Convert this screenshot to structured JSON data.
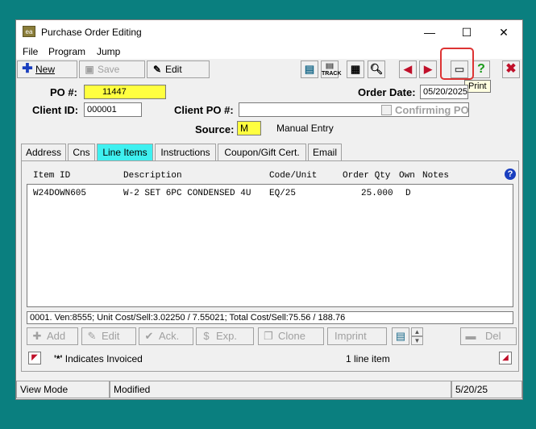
{
  "window": {
    "title": "Purchase Order Editing",
    "icon": "app-icon",
    "controls": {
      "minimize": "—",
      "maximize": "☐",
      "close": "✕"
    }
  },
  "menu": [
    "File",
    "Program",
    "Jump"
  ],
  "toolbar": {
    "new_label": "New",
    "save_label": "Save",
    "edit_label": "Edit",
    "tooltip": "Print",
    "icons": [
      "copy-icon",
      "barcode-track-icon",
      "form-icon",
      "search-icon",
      "prev-arrow-icon",
      "next-arrow-icon",
      "print-icon",
      "help-icon",
      "close-icon"
    ],
    "track_label": "TRACK"
  },
  "header": {
    "po_label": "PO #:",
    "po_value": "11447",
    "order_date_label": "Order Date:",
    "order_date_value": "05/20/2025",
    "client_id_label": "Client ID:",
    "client_id_value": "000001",
    "client_po_label": "Client PO #:",
    "client_po_value": "",
    "confirming_label": "Confirming PO",
    "source_label": "Source:",
    "source_value": "M",
    "source_desc": "Manual Entry"
  },
  "tabs": [
    "Address",
    "Cns",
    "Line Items",
    "Instructions",
    "Coupon/Gift Cert.",
    "Email"
  ],
  "active_tab": "Line Items",
  "grid": {
    "columns": [
      "Item ID",
      "Description",
      "Code/Unit",
      "Order Qty",
      "Own",
      "Notes"
    ],
    "rows": [
      {
        "item_id": "W24DOWN605",
        "description": "W-2 SET 6PC CONDENSED 4U",
        "code_unit": "EQ/25",
        "qty": "25.000",
        "own": "D",
        "notes": ""
      }
    ]
  },
  "detail_line": "0001. Ven:8555; Unit Cost/Sell:3.02250 / 7.55021; Total Cost/Sell:75.56 / 188.76",
  "line_buttons": {
    "add": "Add",
    "edit": "Edit",
    "ack": "Ack.",
    "exp": "Exp.",
    "clone": "Clone",
    "imprint": "Imprint",
    "del": "Del"
  },
  "legend": {
    "invoiced_mark": "'*'",
    "invoiced_text": "Indicates Invoiced",
    "count": "1 line item"
  },
  "statusbar": {
    "mode": "View Mode",
    "state": "Modified",
    "date": "5/20/25"
  }
}
